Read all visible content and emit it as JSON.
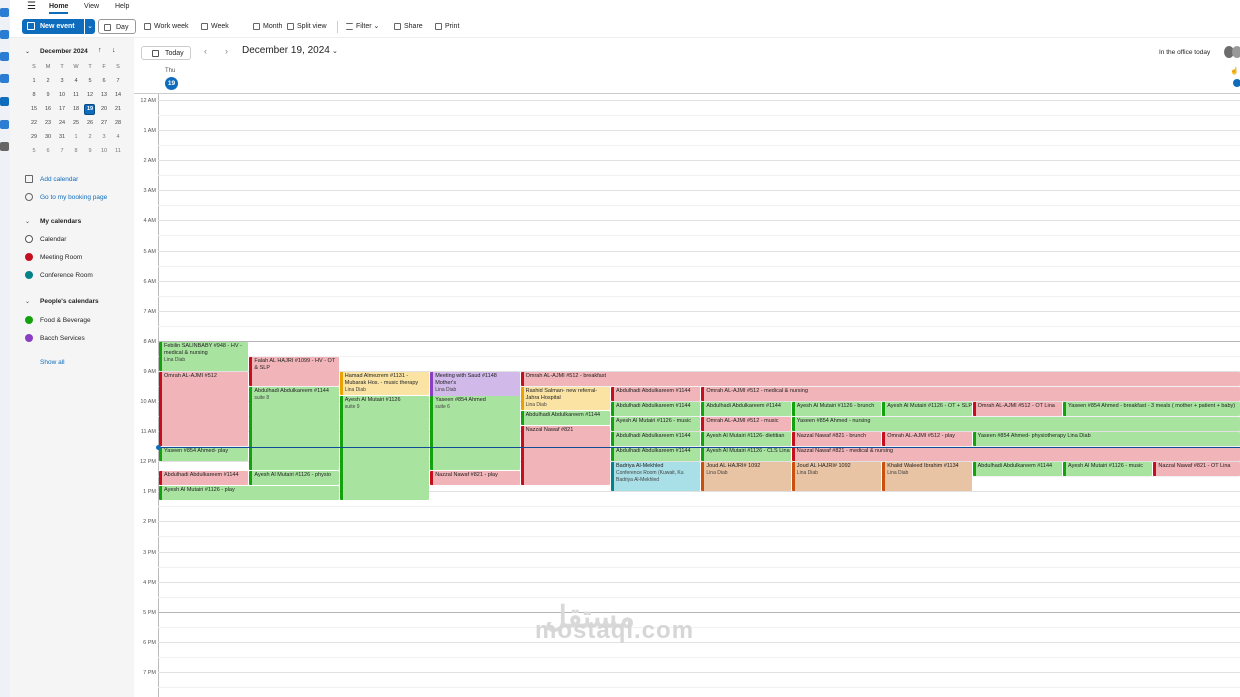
{
  "menu": {
    "home": "Home",
    "view": "View",
    "help": "Help"
  },
  "toolbar": {
    "new_event": "New event",
    "day": "Day",
    "work_week": "Work week",
    "week": "Week",
    "month": "Month",
    "split_view": "Split view",
    "filter": "Filter",
    "share": "Share",
    "print": "Print"
  },
  "mini_calendar": {
    "title": "December 2024",
    "weekdays": [
      "S",
      "M",
      "T",
      "W",
      "T",
      "F",
      "S"
    ],
    "weeks": [
      [
        "1",
        "2",
        "3",
        "4",
        "5",
        "6",
        "7"
      ],
      [
        "8",
        "9",
        "10",
        "11",
        "12",
        "13",
        "14"
      ],
      [
        "15",
        "16",
        "17",
        "18",
        "19",
        "20",
        "21"
      ],
      [
        "22",
        "23",
        "24",
        "25",
        "26",
        "27",
        "28"
      ],
      [
        "29",
        "30",
        "31",
        "1",
        "2",
        "3",
        "4"
      ],
      [
        "5",
        "6",
        "7",
        "8",
        "9",
        "10",
        "11"
      ]
    ],
    "selected": "19"
  },
  "sidebar": {
    "add_calendar": "Add calendar",
    "booking_page": "Go to my booking page",
    "my_calendars": "My calendars",
    "people_calendars": "People's calendars",
    "show_all": "Show all",
    "my_items": [
      {
        "label": "Calendar",
        "color": "#ffffff"
      },
      {
        "label": "Meeting Room",
        "color": "#c50f1f"
      },
      {
        "label": "Conference Room",
        "color": "#038387"
      }
    ],
    "people_items": [
      {
        "label": "Food & Beverage",
        "color": "#13a10e"
      },
      {
        "label": "Bacch Services",
        "color": "#8a3fc3"
      }
    ]
  },
  "datebar": {
    "today": "Today",
    "date_title": "December 19, 2024",
    "in_office": "In the office today"
  },
  "day_header": {
    "dow": "Thu",
    "day": "19"
  },
  "hours": [
    "12 AM",
    "1 AM",
    "2 AM",
    "3 AM",
    "4 AM",
    "5 AM",
    "6 AM",
    "7 AM",
    "8 AM",
    "9 AM",
    "10 AM",
    "11 AM",
    "12 PM",
    "1 PM",
    "2 PM",
    "3 PM",
    "4 PM",
    "5 PM",
    "6 PM",
    "7 PM"
  ],
  "events": [
    {
      "title": "Febilin SALINBABY #948 - HV - medical & nursing",
      "sub": "Lina Diab",
      "color": "green",
      "start": 8.0,
      "end": 9.0,
      "lane": 0
    },
    {
      "title": "Falah AL HAJRI #1099 - HV - OT & SLP",
      "sub": "",
      "color": "red",
      "start": 8.5,
      "end": 9.5,
      "lane": 1
    },
    {
      "title": "Omrah AL-AJMI #512",
      "sub": "",
      "color": "red",
      "start": 9.0,
      "end": 11.5,
      "lane": 0
    },
    {
      "title": "Hamad Almezrem #1131 - Mubarak Hos. - music therapy",
      "sub": "Lina Diab",
      "color": "yellow",
      "start": 9.0,
      "end": 9.8,
      "lane": 2
    },
    {
      "title": "Meeting with Saud #1148 Mother's",
      "sub": "Lina Diab",
      "color": "purple",
      "start": 9.0,
      "end": 9.9,
      "lane": 3
    },
    {
      "title": "Omrah AL-AJMI #512 - breakfast",
      "sub": "",
      "color": "red",
      "start": 9.0,
      "end": 9.5,
      "lane": 4,
      "span": 8
    },
    {
      "title": "Abdulhadi Abdulkareem #1144",
      "sub": "suite 8",
      "color": "green",
      "start": 9.5,
      "end": 12.3,
      "lane": 1
    },
    {
      "title": "Rashid Salman- new referral- Jahra Hospital",
      "sub": "Lina Diab",
      "color": "yellow",
      "start": 9.5,
      "end": 10.3,
      "lane": 4
    },
    {
      "title": "Abdulhadi Abdulkareem #1144",
      "sub": "",
      "color": "red",
      "start": 9.5,
      "end": 10.0,
      "lane": 5
    },
    {
      "title": "Omrah AL-AJMI #512 - medical & nursing",
      "sub": "",
      "color": "red",
      "start": 9.5,
      "end": 10.0,
      "lane": 6,
      "span": 6
    },
    {
      "title": "Ayesh Al Mutairi #1126",
      "sub": "suite 9",
      "color": "green",
      "start": 9.8,
      "end": 13.3,
      "lane": 2
    },
    {
      "title": "Yaseen #854 Ahmed",
      "sub": "suite 6",
      "color": "green",
      "start": 9.8,
      "end": 12.3,
      "lane": 3
    },
    {
      "title": "Abdulhadi Abdulkareem #1144",
      "sub": "",
      "color": "green",
      "start": 10.0,
      "end": 10.5,
      "lane": 5
    },
    {
      "title": "Abdulhadi Abdulkareem #1144",
      "sub": "",
      "color": "green",
      "start": 10.0,
      "end": 10.5,
      "lane": 6
    },
    {
      "title": "Ayesh Al Mutairi #1126 - brunch",
      "sub": "",
      "color": "green",
      "start": 10.0,
      "end": 10.5,
      "lane": 7
    },
    {
      "title": "Ayesh Al Mutairi #1126 - OT + SLP",
      "sub": "",
      "color": "green",
      "start": 10.0,
      "end": 10.5,
      "lane": 8
    },
    {
      "title": "Omrah AL-AJMI #512 - OT Lina",
      "sub": "",
      "color": "red",
      "start": 10.0,
      "end": 10.5,
      "lane": 9
    },
    {
      "title": "Yaseen #854 Ahmed - breakfast - 3 meals ( mother + patient + baby)",
      "sub": "",
      "color": "green",
      "start": 10.0,
      "end": 10.5,
      "lane": 10,
      "span": 2
    },
    {
      "title": "Abdulhadi Abdulkareem #1144",
      "sub": "",
      "color": "green",
      "start": 10.3,
      "end": 10.8,
      "lane": 4
    },
    {
      "title": "Ayesh Al Mutairi #1126 - music",
      "sub": "",
      "color": "green",
      "start": 10.5,
      "end": 11.0,
      "lane": 5
    },
    {
      "title": "Omrah AL-AJMI #512 - music",
      "sub": "",
      "color": "red",
      "start": 10.5,
      "end": 11.0,
      "lane": 6
    },
    {
      "title": "Yaseen #854 Ahmed - nursing",
      "sub": "",
      "color": "green",
      "start": 10.5,
      "end": 11.0,
      "lane": 7,
      "span": 5
    },
    {
      "title": "Nazzal Nawaf #821",
      "sub": "",
      "color": "red",
      "start": 10.8,
      "end": 12.8,
      "lane": 4
    },
    {
      "title": "Abdulhadi Abdulkareem #1144",
      "sub": "",
      "color": "green",
      "start": 11.0,
      "end": 11.5,
      "lane": 5
    },
    {
      "title": "Ayesh Al Mutairi #1126- dietitian",
      "sub": "",
      "color": "green",
      "start": 11.0,
      "end": 11.5,
      "lane": 6
    },
    {
      "title": "Nazzal Nawaf #821 - brunch",
      "sub": "",
      "color": "red",
      "start": 11.0,
      "end": 11.5,
      "lane": 7
    },
    {
      "title": "Omrah AL-AJMI #512 - play",
      "sub": "",
      "color": "red",
      "start": 11.0,
      "end": 11.5,
      "lane": 8
    },
    {
      "title": "Yaseen #854 Ahmed- physiotherapy Lina Diab",
      "sub": "",
      "color": "green",
      "start": 11.0,
      "end": 11.5,
      "lane": 9,
      "span": 3
    },
    {
      "title": "Yaseen #854 Ahmed- play",
      "sub": "",
      "color": "green",
      "start": 11.5,
      "end": 12.0,
      "lane": 0
    },
    {
      "title": "Abdulhadi Abdulkareem #1144",
      "sub": "",
      "color": "green",
      "start": 11.5,
      "end": 12.0,
      "lane": 5
    },
    {
      "title": "Ayesh Al Mutairi #1126 - CLS Lina",
      "sub": "",
      "color": "green",
      "start": 11.5,
      "end": 12.0,
      "lane": 6
    },
    {
      "title": "Nazzal Nawaf #821 - medical & nursing",
      "sub": "",
      "color": "red",
      "start": 11.5,
      "end": 12.0,
      "lane": 7,
      "span": 5
    },
    {
      "title": "Badriya Al-Mekhled",
      "sub": "Conference Room (Kuwait, Ku Badriya Al-Mekhled",
      "color": "teal",
      "start": 12.0,
      "end": 13.0,
      "lane": 5
    },
    {
      "title": "Joud AL HAJRI# 1092",
      "sub": "Lina Diab",
      "color": "brown",
      "start": 12.0,
      "end": 13.0,
      "lane": 6
    },
    {
      "title": "Joud AL HAJRI# 1092",
      "sub": "Lina Diab",
      "color": "brown",
      "start": 12.0,
      "end": 13.0,
      "lane": 7
    },
    {
      "title": "Khalid Waleed Ibrahim #1134",
      "sub": "Lina Diab",
      "color": "brown",
      "start": 12.0,
      "end": 13.0,
      "lane": 8
    },
    {
      "title": "Abdulhadi Abdulkareem #1144",
      "sub": "",
      "color": "green",
      "start": 12.0,
      "end": 12.5,
      "lane": 9
    },
    {
      "title": "Ayesh Al Mutairi #1126 - music",
      "sub": "",
      "color": "green",
      "start": 12.0,
      "end": 12.5,
      "lane": 10
    },
    {
      "title": "Nazzal Nawaf #821 - OT Lina",
      "sub": "",
      "color": "red",
      "start": 12.0,
      "end": 12.5,
      "lane": 11
    },
    {
      "title": "Abdulhadi Abdulkareem #1144",
      "sub": "",
      "color": "red",
      "start": 12.3,
      "end": 12.8,
      "lane": 0
    },
    {
      "title": "Ayesh Al Mutairi #1126 - physio",
      "sub": "",
      "color": "green",
      "start": 12.3,
      "end": 12.8,
      "lane": 1
    },
    {
      "title": "Nazzal Nawaf #821 - play",
      "sub": "",
      "color": "red",
      "start": 12.3,
      "end": 12.8,
      "lane": 3
    },
    {
      "title": "Ayesh Al Mutairi #1126 - play",
      "sub": "",
      "color": "green",
      "start": 12.8,
      "end": 13.3,
      "lane": 0,
      "span": 2
    }
  ],
  "now_time": 11.53,
  "watermark": {
    "arabic": "مستقل",
    "latin": "mostaql.com"
  }
}
